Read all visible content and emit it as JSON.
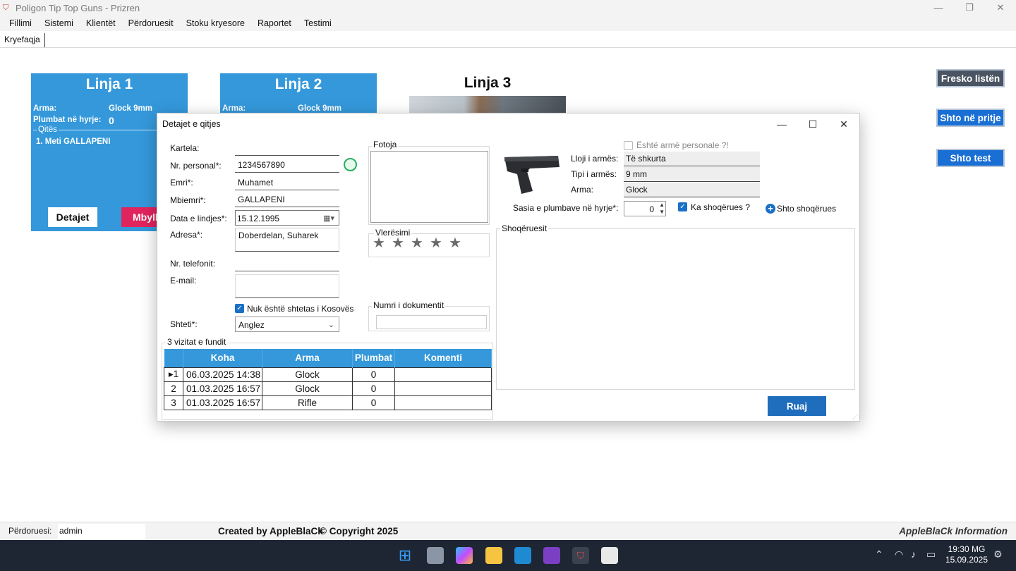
{
  "app": {
    "title": "Poligon  Tip Top Guns   - Prizren",
    "controls": {
      "minimize": "—",
      "restore": "❐",
      "close": "✕"
    }
  },
  "menu": [
    "Fillimi",
    "Sistemi",
    "Klientët",
    "Përdoruesit",
    "Stoku kryesore",
    "Raportet",
    "Testimi"
  ],
  "tab": "Kryefaqja",
  "lines": [
    {
      "title": "Linja 1",
      "arma_label": "Arma:",
      "arma_value": "Glock 9mm",
      "plumbat_label": "Plumbat në hyrje:",
      "plumbat_value": "0",
      "qites_label": "Qitës",
      "qites_item": "1. Meti GALLAPENI",
      "details_btn": "Detajet",
      "close_btn": "Mbyll"
    },
    {
      "title": "Linja 2",
      "arma_label": "Arma:",
      "arma_value": "Glock 9mm"
    },
    {
      "title": "Linja 3"
    }
  ],
  "side_buttons": {
    "refresh": "Fresko listën",
    "add_wait": "Shto në pritje",
    "add_test": "Shto test"
  },
  "dialog": {
    "title": "Detajet e qitjes",
    "controls": {
      "minimize": "—",
      "maximize": "☐",
      "close": "✕"
    },
    "fields": {
      "kartela_label": "Kartela:",
      "kartela_value": "",
      "nr_personal_label": "Nr. personal*:",
      "nr_personal_value": "1234567890",
      "emri_label": "Emri*:",
      "emri_value": "Muhamet",
      "mbiemri_label": "Mbiemri*:",
      "mbiemri_value": "GALLAPENI",
      "dob_label": "Data e lindjes*:",
      "dob_value": "15.12.1995",
      "adresa_label": "Adresa*:",
      "adresa_value": "Doberdelan, Suharek",
      "tel_label": "Nr. telefonit:",
      "tel_value": "",
      "email_label": "E-mail:",
      "email_value": "",
      "not_kosovo_label": "Nuk është shtetas i Kosovës",
      "not_kosovo_checked": true,
      "shteti_label": "Shteti*:",
      "shteti_value": "Anglez"
    },
    "photo_label": "Fotoja",
    "rating_label": "Vlerësimi",
    "rating_stars": 5,
    "doc_label": "Numri i dokumentit",
    "doc_value": "",
    "weapon": {
      "personal_label": "Është armë personale ?!",
      "personal_checked": false,
      "lloji_label": "Lloji i armës:",
      "lloji_value": "Të shkurta",
      "tipi_label": "Tipi i armës:",
      "tipi_value": "9 mm",
      "arma_label": "Arma:",
      "arma_value": "Glock",
      "sasia_label": "Sasia e plumbave në hyrje*:",
      "sasia_value": "0",
      "companions_label": "Ka shoqërues ?",
      "companions_checked": true,
      "add_companion": "Shto shoqërues",
      "companions_group": "Shoqëruesit"
    },
    "visits": {
      "label": "3 vizitat e fundit",
      "headers": [
        "Koha",
        "Arma",
        "Plumbat",
        "Komenti"
      ],
      "rows": [
        {
          "idx": "1",
          "koha": "06.03.2025 14:38",
          "arma": "Glock",
          "plumbat": "0",
          "komenti": ""
        },
        {
          "idx": "2",
          "koha": "01.03.2025 16:57",
          "arma": "Glock",
          "plumbat": "0",
          "komenti": ""
        },
        {
          "idx": "3",
          "koha": "01.03.2025 16:57",
          "arma": "Rifle",
          "plumbat": "0",
          "komenti": ""
        }
      ]
    },
    "save_btn": "Ruaj"
  },
  "footer": {
    "user_label": "Përdoruesi:",
    "user_value": "admin",
    "created": "Created by AppleBlaCk",
    "copyright": "© Copyright 2025",
    "info": "AppleBlaCk Information"
  },
  "taskbar": {
    "time": "19:30 MG",
    "date": "15.09.2025"
  },
  "colors": {
    "accent_blue": "#3498db",
    "button_blue": "#1f6dbd",
    "danger": "#e0245e",
    "taskbar": "#1e2634"
  }
}
